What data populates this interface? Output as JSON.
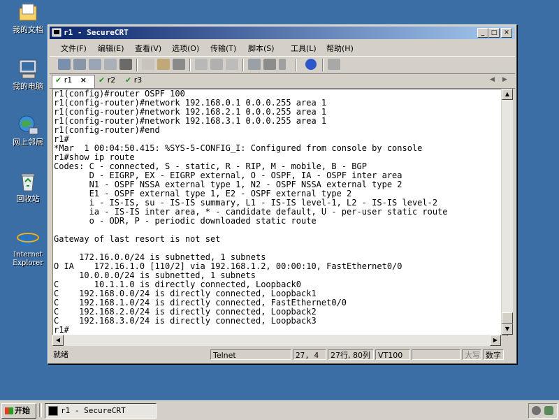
{
  "desktop": {
    "icons": [
      {
        "label": "我的文档",
        "icon": "folder-documents-icon"
      },
      {
        "label": "我的电脑",
        "icon": "computer-icon"
      },
      {
        "label": "网上邻居",
        "icon": "network-icon"
      },
      {
        "label": "回收站",
        "icon": "recycle-bin-icon"
      },
      {
        "label": "Internet Explorer",
        "icon": "internet-explorer-icon"
      }
    ]
  },
  "window": {
    "title": "r1 - SecureCRT",
    "menus": [
      "文件(F)",
      "编辑(E)",
      "查看(V)",
      "选项(O)",
      "传输(T)",
      "脚本(S)",
      "工具(L)",
      "帮助(H)"
    ],
    "tabs": [
      {
        "label": "r1",
        "close": "×"
      },
      {
        "label": "r2"
      },
      {
        "label": "r3"
      }
    ],
    "terminal_lines": [
      "r1(config)#router OSPF 100",
      "r1(config-router)#network 192.168.0.1 0.0.0.255 area 1",
      "r1(config-router)#network 192.168.2.1 0.0.0.255 area 1",
      "r1(config-router)#network 192.168.3.1 0.0.0.255 area 1",
      "r1(config-router)#end",
      "r1#",
      "*Mar  1 00:04:50.415: %SYS-5-CONFIG_I: Configured from console by console",
      "r1#show ip route",
      "Codes: C - connected, S - static, R - RIP, M - mobile, B - BGP",
      "       D - EIGRP, EX - EIGRP external, O - OSPF, IA - OSPF inter area",
      "       N1 - OSPF NSSA external type 1, N2 - OSPF NSSA external type 2",
      "       E1 - OSPF external type 1, E2 - OSPF external type 2",
      "       i - IS-IS, su - IS-IS summary, L1 - IS-IS level-1, L2 - IS-IS level-2",
      "       ia - IS-IS inter area, * - candidate default, U - per-user static route",
      "       o - ODR, P - periodic downloaded static route",
      "",
      "Gateway of last resort is not set",
      "",
      "     172.16.0.0/24 is subnetted, 1 subnets",
      "O IA    172.16.1.0 [110/2] via 192.168.1.2, 00:00:10, FastEthernet0/0",
      "     10.0.0.0/24 is subnetted, 1 subnets",
      "C       10.1.1.0 is directly connected, Loopback0",
      "C    192.168.0.0/24 is directly connected, Loopback1",
      "C    192.168.1.0/24 is directly connected, FastEthernet0/0",
      "C    192.168.2.0/24 is directly connected, Loopback2",
      "C    192.168.3.0/24 is directly connected, Loopback3",
      "r1#"
    ],
    "status": {
      "ready": "就绪",
      "protocol": "Telnet",
      "cursor": "27,  4",
      "size": "27行, 80列",
      "emulation": "VT100",
      "caps": "大写",
      "num": "数字"
    }
  },
  "taskbar": {
    "start_label": "开始",
    "task_label": "r1 - SecureCRT"
  }
}
